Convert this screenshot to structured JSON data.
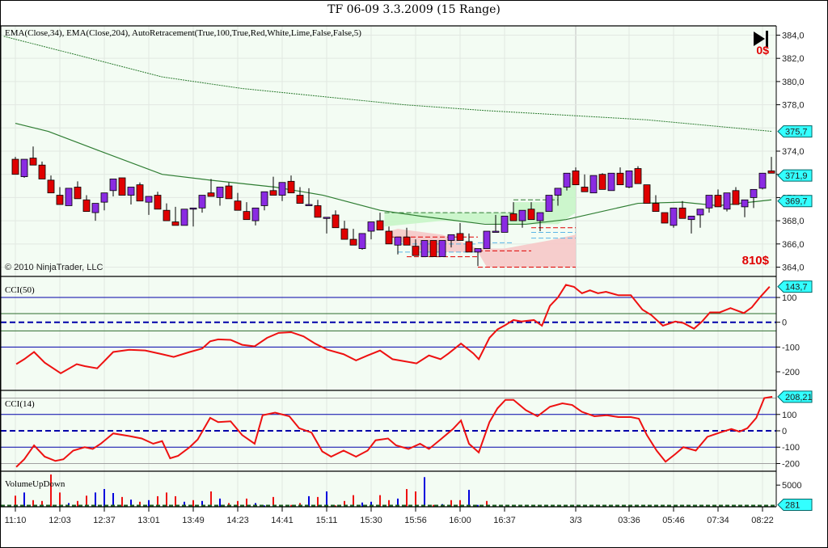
{
  "window": {
    "title": "TF 06-09  3.3.2009 (15 Range)"
  },
  "price_panel": {
    "indicator_label": "EMA(Close,34), EMA(Close,204), AutoRetracement(True,100,True,Red,White,Lime,False,False,5)",
    "copyright": "© 2010 NinjaTrader, LLC",
    "pnl_top": "0$",
    "pnl_bottom": "810$",
    "play_icon": "skip-to-end-icon",
    "y_ticks": [
      "384,0",
      "382,0",
      "380,0",
      "378,0",
      "376,0",
      "374,0",
      "372,0",
      "370,0",
      "368,0",
      "366,0",
      "364,0"
    ],
    "y_tick_values": [
      384,
      382,
      380,
      378,
      376,
      374,
      372,
      370,
      368,
      366,
      364
    ],
    "ylim": [
      363.2,
      384.8
    ],
    "readouts": [
      {
        "label": "375,7",
        "value": 375.7
      },
      {
        "label": "371,9",
        "value": 371.9
      },
      {
        "label": "369,7",
        "value": 369.7
      }
    ],
    "colors": {
      "up": "#8a2be2",
      "down": "#e00000",
      "ema34": "#2e7d32",
      "ema204": "#2e7d32",
      "readout": "#33ffff",
      "pnl": "#e00000"
    },
    "bars_ohlc": [
      [
        373.3,
        373.5,
        372.0,
        372.0
      ],
      [
        371.8,
        373.3,
        371.7,
        373.3
      ],
      [
        373.4,
        374.4,
        372.8,
        372.8
      ],
      [
        372.8,
        373.1,
        371.6,
        371.6
      ],
      [
        371.5,
        371.9,
        370.4,
        370.4
      ],
      [
        370.2,
        370.9,
        369.4,
        369.4
      ],
      [
        369.3,
        370.8,
        369.3,
        370.8
      ],
      [
        370.9,
        371.4,
        369.9,
        369.9
      ],
      [
        369.8,
        370.2,
        368.8,
        368.8
      ],
      [
        368.7,
        369.5,
        368.0,
        369.5
      ],
      [
        369.6,
        370.4,
        368.9,
        370.4
      ],
      [
        370.6,
        371.6,
        370.1,
        371.6
      ],
      [
        371.7,
        371.7,
        370.2,
        370.2
      ],
      [
        370.2,
        370.9,
        369.4,
        370.9
      ],
      [
        371.1,
        371.3,
        369.7,
        369.7
      ],
      [
        369.6,
        370.1,
        368.5,
        370.1
      ],
      [
        370.2,
        370.5,
        369.0,
        369.0
      ],
      [
        368.9,
        369.5,
        368.0,
        368.0
      ],
      [
        367.9,
        369.2,
        367.6,
        367.6
      ],
      [
        367.6,
        369.0,
        367.6,
        369.0
      ],
      [
        369.1,
        369.1,
        367.5,
        369.1
      ],
      [
        369.1,
        370.2,
        368.7,
        370.2
      ],
      [
        370.4,
        371.6,
        370.1,
        370.1
      ],
      [
        370.0,
        370.9,
        369.3,
        370.9
      ],
      [
        371.0,
        371.3,
        369.9,
        369.9
      ],
      [
        369.7,
        370.4,
        368.9,
        368.9
      ],
      [
        368.8,
        369.6,
        368.1,
        368.1
      ],
      [
        368.0,
        369.1,
        367.6,
        369.1
      ],
      [
        369.3,
        370.5,
        368.9,
        370.5
      ],
      [
        370.6,
        371.8,
        370.2,
        370.2
      ],
      [
        370.2,
        371.3,
        369.7,
        371.3
      ],
      [
        371.4,
        371.9,
        370.4,
        370.4
      ],
      [
        370.2,
        370.9,
        369.5,
        369.5
      ],
      [
        369.4,
        370.8,
        369.4,
        369.4
      ],
      [
        369.3,
        369.8,
        368.3,
        368.3
      ],
      [
        368.3,
        368.3,
        366.9,
        368.3
      ],
      [
        368.5,
        368.9,
        367.4,
        367.4
      ],
      [
        367.3,
        368.0,
        366.4,
        366.4
      ],
      [
        366.4,
        367.3,
        365.9,
        365.9
      ],
      [
        365.6,
        366.9,
        365.5,
        366.9
      ],
      [
        367.1,
        367.9,
        366.4,
        367.9
      ],
      [
        368.0,
        368.7,
        367.2,
        367.2
      ],
      [
        367.1,
        367.5,
        366.0,
        366.0
      ],
      [
        365.9,
        366.6,
        365.1,
        366.6
      ],
      [
        366.6,
        367.4,
        365.9,
        365.9
      ],
      [
        365.8,
        366.4,
        365.0,
        365.0
      ],
      [
        364.9,
        366.3,
        364.9,
        366.3
      ],
      [
        366.3,
        366.3,
        364.9,
        364.9
      ],
      [
        364.9,
        366.3,
        364.9,
        366.3
      ],
      [
        366.3,
        366.8,
        365.7,
        366.8
      ],
      [
        366.9,
        367.8,
        366.3,
        366.3
      ],
      [
        366.2,
        366.9,
        365.3,
        365.3
      ],
      [
        365.3,
        365.6,
        364.1,
        365.6
      ],
      [
        365.6,
        367.1,
        365.6,
        367.1
      ],
      [
        367.1,
        368.5,
        367.1,
        367.1
      ],
      [
        367.0,
        368.4,
        367.0,
        368.4
      ],
      [
        368.6,
        369.6,
        368.0,
        368.0
      ],
      [
        368.0,
        368.9,
        367.4,
        368.9
      ],
      [
        369.0,
        369.6,
        368.1,
        368.1
      ],
      [
        368.0,
        368.7,
        367.1,
        368.7
      ],
      [
        368.8,
        370.2,
        368.8,
        370.2
      ],
      [
        370.2,
        370.8,
        369.3,
        370.8
      ],
      [
        370.9,
        372.1,
        370.6,
        372.1
      ],
      [
        372.3,
        372.6,
        371.1,
        371.1
      ],
      [
        370.9,
        372.0,
        370.5,
        370.5
      ],
      [
        370.4,
        371.9,
        370.4,
        371.9
      ],
      [
        372.0,
        372.1,
        370.7,
        370.7
      ],
      [
        370.6,
        372.1,
        370.6,
        372.1
      ],
      [
        372.1,
        372.6,
        371.1,
        371.1
      ],
      [
        370.9,
        372.3,
        370.8,
        372.3
      ],
      [
        372.5,
        372.7,
        371.2,
        371.2
      ],
      [
        371.1,
        371.1,
        369.5,
        369.5
      ],
      [
        369.5,
        370.2,
        368.8,
        368.8
      ],
      [
        368.7,
        368.7,
        367.8,
        367.8
      ],
      [
        367.6,
        369.1,
        367.4,
        369.1
      ],
      [
        369.1,
        369.7,
        368.2,
        368.2
      ],
      [
        368.1,
        368.4,
        366.9,
        368.4
      ],
      [
        368.5,
        369.0,
        367.4,
        369.0
      ],
      [
        369.1,
        370.2,
        368.7,
        370.2
      ],
      [
        370.2,
        370.7,
        369.2,
        369.2
      ],
      [
        369.0,
        370.4,
        368.8,
        370.4
      ],
      [
        370.6,
        370.9,
        369.4,
        369.4
      ],
      [
        369.2,
        369.8,
        368.3,
        369.8
      ],
      [
        370.0,
        370.7,
        369.1,
        370.7
      ],
      [
        370.8,
        372.1,
        370.7,
        372.1
      ],
      [
        372.3,
        373.5,
        372.1,
        372.1
      ]
    ],
    "ema34": [
      [
        0,
        376.4
      ],
      [
        3.7,
        375.7
      ],
      [
        9.2,
        374.1
      ],
      [
        16.5,
        372.0
      ],
      [
        21.9,
        371.5
      ],
      [
        29.2,
        370.9
      ],
      [
        34.6,
        370.2
      ],
      [
        41,
        368.9
      ],
      [
        45.5,
        368.4
      ],
      [
        52.8,
        367.7
      ],
      [
        57.4,
        367.7
      ],
      [
        61.9,
        368.1
      ],
      [
        70,
        369.5
      ],
      [
        75,
        369.6
      ],
      [
        79,
        369.3
      ],
      [
        85,
        369.8
      ]
    ],
    "ema204": [
      [
        -1.3,
        383.9
      ],
      [
        7.4,
        382.2
      ],
      [
        16.5,
        380.4
      ],
      [
        25.5,
        379.4
      ],
      [
        34.6,
        378.7
      ],
      [
        43.7,
        378.0
      ],
      [
        52.8,
        377.5
      ],
      [
        61.9,
        377.1
      ],
      [
        71,
        376.7
      ],
      [
        85.1,
        375.7
      ]
    ]
  },
  "cci50": {
    "label": "CCI(50)",
    "readout": "143,7",
    "y_ticks": [
      "100",
      "0",
      "-100",
      "-200"
    ],
    "y_tick_values": [
      100,
      0,
      -100,
      -200
    ],
    "ylim": [
      -275,
      185
    ],
    "series": [
      [
        0.1,
        -169
      ],
      [
        1,
        -149
      ],
      [
        2.1,
        -120
      ],
      [
        3.3,
        -163
      ],
      [
        5.1,
        -206
      ],
      [
        6.9,
        -169
      ],
      [
        7.8,
        -177
      ],
      [
        9.2,
        -186
      ],
      [
        11,
        -120
      ],
      [
        12.8,
        -111
      ],
      [
        14.6,
        -114
      ],
      [
        16.5,
        -129
      ],
      [
        17.8,
        -140
      ],
      [
        19.6,
        -120
      ],
      [
        21,
        -106
      ],
      [
        21.9,
        -77
      ],
      [
        22.8,
        -69
      ],
      [
        24.2,
        -71
      ],
      [
        25.5,
        -91
      ],
      [
        26.9,
        -97
      ],
      [
        28.3,
        -63
      ],
      [
        29.6,
        -43
      ],
      [
        31,
        -40
      ],
      [
        32.4,
        -57
      ],
      [
        33.7,
        -86
      ],
      [
        35.1,
        -111
      ],
      [
        36.9,
        -129
      ],
      [
        38.3,
        -154
      ],
      [
        39.6,
        -134
      ],
      [
        41,
        -114
      ],
      [
        42.4,
        -149
      ],
      [
        43.7,
        -157
      ],
      [
        45.1,
        -166
      ],
      [
        46.5,
        -134
      ],
      [
        47.8,
        -149
      ],
      [
        48.7,
        -126
      ],
      [
        50.1,
        -86
      ],
      [
        51.5,
        -126
      ],
      [
        52.1,
        -149
      ],
      [
        53.3,
        -63
      ],
      [
        54.2,
        -29
      ],
      [
        55.1,
        -11
      ],
      [
        56,
        9
      ],
      [
        56.9,
        3
      ],
      [
        58.3,
        9
      ],
      [
        59.2,
        -14
      ],
      [
        60.1,
        66
      ],
      [
        61,
        100
      ],
      [
        61.9,
        151
      ],
      [
        62.8,
        143
      ],
      [
        63.7,
        117
      ],
      [
        64.6,
        129
      ],
      [
        65.5,
        117
      ],
      [
        66.4,
        123
      ],
      [
        67.8,
        109
      ],
      [
        69.2,
        109
      ],
      [
        70.5,
        51
      ],
      [
        71.5,
        29
      ],
      [
        72.8,
        -14
      ],
      [
        74.2,
        3
      ],
      [
        75.1,
        -3
      ],
      [
        76.3,
        -26
      ],
      [
        77.2,
        3
      ],
      [
        78.1,
        40
      ],
      [
        79.2,
        40
      ],
      [
        80.4,
        57
      ],
      [
        81.9,
        37
      ],
      [
        82.8,
        60
      ],
      [
        83.7,
        100
      ],
      [
        84.8,
        143.7
      ]
    ]
  },
  "cci14": {
    "label": "CCI(14)",
    "readout": "208,21",
    "y_ticks": [
      "100",
      "0",
      "-100",
      "-200"
    ],
    "y_tick_values": [
      100,
      0,
      -100,
      -200
    ],
    "ylim": [
      -247,
      247
    ],
    "series": [
      [
        0.1,
        -221
      ],
      [
        1,
        -174
      ],
      [
        2.1,
        -89
      ],
      [
        3.3,
        -158
      ],
      [
        4.5,
        -184
      ],
      [
        5.4,
        -174
      ],
      [
        6.5,
        -121
      ],
      [
        7.8,
        -100
      ],
      [
        8.7,
        -111
      ],
      [
        9.6,
        -79
      ],
      [
        11,
        -16
      ],
      [
        12.8,
        -32
      ],
      [
        14.2,
        -47
      ],
      [
        15.5,
        -79
      ],
      [
        16.5,
        -63
      ],
      [
        17.4,
        -168
      ],
      [
        18.3,
        -153
      ],
      [
        19.6,
        -100
      ],
      [
        20.5,
        -53
      ],
      [
        21.9,
        79
      ],
      [
        22.8,
        53
      ],
      [
        24.2,
        58
      ],
      [
        25.5,
        -26
      ],
      [
        26.9,
        -79
      ],
      [
        27.8,
        95
      ],
      [
        29.2,
        111
      ],
      [
        30.8,
        89
      ],
      [
        31.9,
        16
      ],
      [
        33.3,
        -11
      ],
      [
        34.5,
        -126
      ],
      [
        35.5,
        -158
      ],
      [
        36.9,
        -121
      ],
      [
        38.3,
        -158
      ],
      [
        39.6,
        -121
      ],
      [
        40.5,
        -58
      ],
      [
        41.9,
        -47
      ],
      [
        42.8,
        -89
      ],
      [
        44.2,
        -111
      ],
      [
        45.5,
        -79
      ],
      [
        46.5,
        -111
      ],
      [
        47.8,
        -53
      ],
      [
        49.2,
        11
      ],
      [
        50.1,
        63
      ],
      [
        51,
        -79
      ],
      [
        52.1,
        -132
      ],
      [
        53.3,
        53
      ],
      [
        54.2,
        137
      ],
      [
        55.1,
        189
      ],
      [
        56,
        189
      ],
      [
        57.4,
        126
      ],
      [
        58.7,
        89
      ],
      [
        60.1,
        147
      ],
      [
        61.5,
        168
      ],
      [
        62.6,
        158
      ],
      [
        63.7,
        116
      ],
      [
        65.1,
        89
      ],
      [
        66.5,
        95
      ],
      [
        67.8,
        84
      ],
      [
        69.2,
        84
      ],
      [
        70.1,
        74
      ],
      [
        71,
        -26
      ],
      [
        72.1,
        -121
      ],
      [
        73.1,
        -189
      ],
      [
        74.2,
        -142
      ],
      [
        75.1,
        -100
      ],
      [
        76.5,
        -121
      ],
      [
        77.8,
        -37
      ],
      [
        79.2,
        -11
      ],
      [
        80.5,
        11
      ],
      [
        81.4,
        -5
      ],
      [
        82.3,
        16
      ],
      [
        83.3,
        79
      ],
      [
        84.2,
        200
      ],
      [
        85.1,
        208.21
      ]
    ]
  },
  "volume": {
    "label": "VolumeUpDown",
    "readout": "281",
    "y_ticks": [
      "5000"
    ],
    "y_tick_values": [
      5000
    ],
    "ylim": [
      0,
      8200
    ],
    "bars": [
      [
        "down",
        2560
      ],
      [
        "up",
        3290
      ],
      [
        "down",
        1530
      ],
      [
        "down",
        1340
      ],
      [
        "down",
        7440
      ],
      [
        "down",
        3290
      ],
      [
        "up",
        850
      ],
      [
        "down",
        1340
      ],
      [
        "down",
        2560
      ],
      [
        "up",
        3290
      ],
      [
        "up",
        4090
      ],
      [
        "up",
        3170
      ],
      [
        "down",
        2260
      ],
      [
        "up",
        1650
      ],
      [
        "down",
        1160
      ],
      [
        "up",
        1530
      ],
      [
        "down",
        2440
      ],
      [
        "down",
        3290
      ],
      [
        "down",
        2440
      ],
      [
        "up",
        1160
      ],
      [
        "down",
        1530
      ],
      [
        "up",
        1340
      ],
      [
        "down",
        3540
      ],
      [
        "up",
        1890
      ],
      [
        "down",
        850
      ],
      [
        "down",
        1340
      ],
      [
        "down",
        1890
      ],
      [
        "up",
        850
      ],
      [
        "up",
        310
      ],
      [
        "down",
        2260
      ],
      [
        "up",
        430
      ],
      [
        "down",
        430
      ],
      [
        "down",
        850
      ],
      [
        "up",
        2440
      ],
      [
        "down",
        2260
      ],
      [
        "up",
        3540
      ],
      [
        "down",
        310
      ],
      [
        "down",
        1340
      ],
      [
        "down",
        2680
      ],
      [
        "up",
        980
      ],
      [
        "up",
        1160
      ],
      [
        "down",
        2680
      ],
      [
        "down",
        1530
      ],
      [
        "up",
        1890
      ],
      [
        "down",
        4090
      ],
      [
        "down",
        3540
      ],
      [
        "up",
        6830
      ],
      [
        "down",
        430
      ],
      [
        "up",
        610
      ],
      [
        "down",
        1530
      ],
      [
        "down",
        1530
      ],
      [
        "up",
        3900
      ],
      [
        "up",
        430
      ],
      [
        "down",
        1340
      ]
    ]
  },
  "x_axis": {
    "labels": [
      "11:10",
      "12:03",
      "12:37",
      "13:01",
      "13:49",
      "14:23",
      "14:41",
      "15:11",
      "15:30",
      "15:56",
      "16:00",
      "16:37",
      "3/3",
      "03:36",
      "05:46",
      "07:34",
      "08:22"
    ],
    "label_bars": [
      0,
      5,
      10,
      15,
      20,
      25,
      30,
      35,
      40,
      45,
      50,
      55,
      63,
      69,
      74,
      79,
      84
    ]
  }
}
